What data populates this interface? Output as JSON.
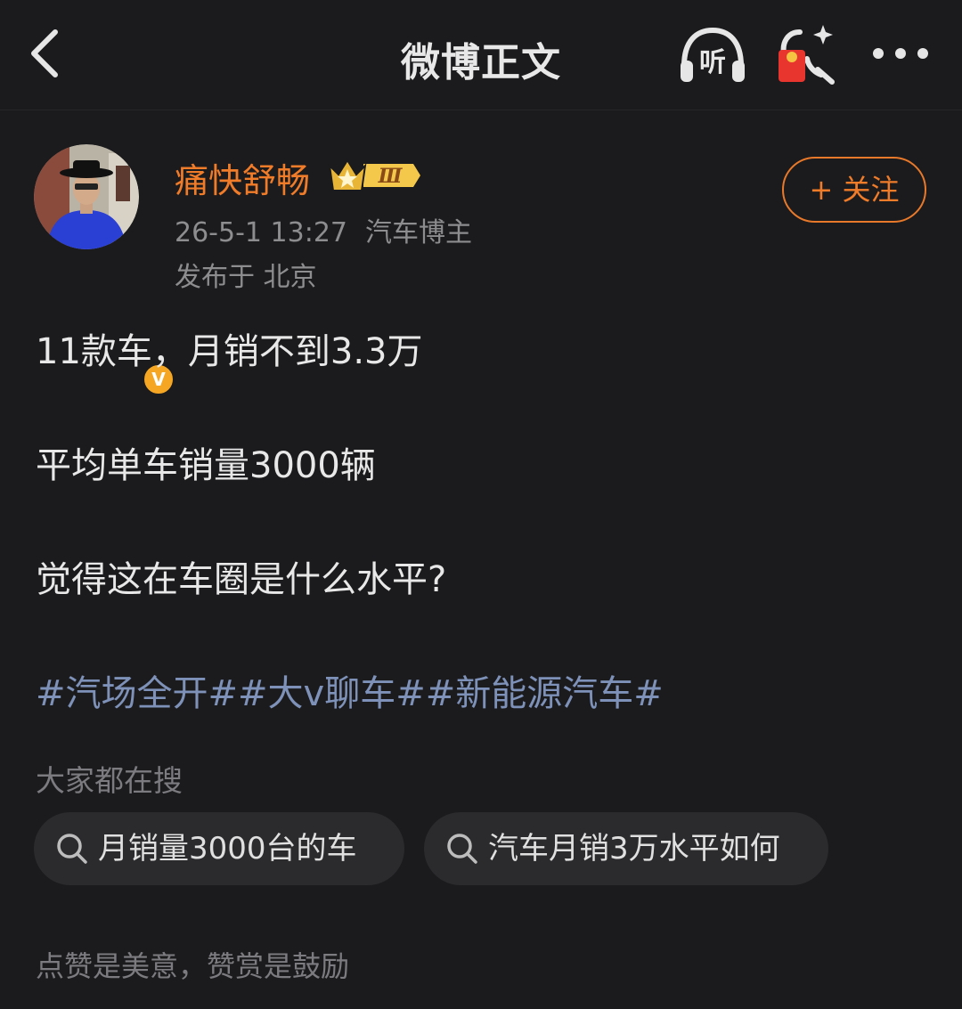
{
  "header": {
    "title": "微博正文",
    "listen_label": "听",
    "icons": [
      "back-icon",
      "listen-headphones-icon",
      "red-packet-icon",
      "more-icon"
    ]
  },
  "author": {
    "name": "痛快舒畅",
    "level_badge": "Ⅲ",
    "verified_mark": "V",
    "timestamp": "26-5-1 13:27",
    "role": "汽车博主",
    "location": "发布于 北京",
    "follow_label": "+ 关注"
  },
  "post": {
    "lines": [
      "11款车，月销不到3.3万",
      "平均单车销量3000辆",
      "觉得这在车圈是什么水平?"
    ],
    "hashtags": [
      "#汽场全开#",
      "#大v聊车#",
      "#新能源汽车#"
    ]
  },
  "search": {
    "heading": "大家都在搜",
    "items": [
      "月销量3000台的车",
      "汽车月销3万水平如何"
    ]
  },
  "footer": {
    "reward_text": "点赞是美意，赞赏是鼓励"
  },
  "colors": {
    "background": "#1b1b1d",
    "accent_orange": "#f07c2a",
    "hashtag_blue": "#7e91b8",
    "muted_text": "#8d8d90",
    "chip_bg": "#2b2b2e"
  }
}
